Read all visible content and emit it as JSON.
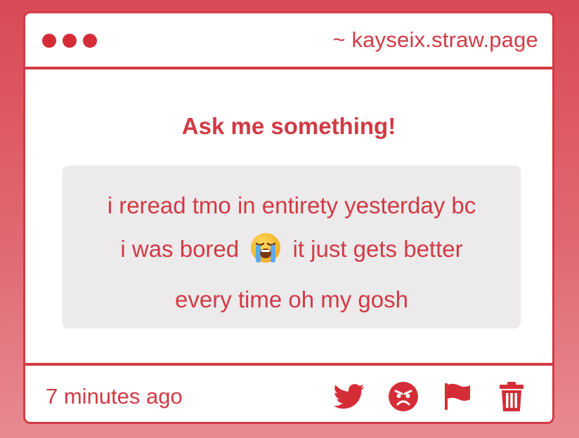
{
  "window": {
    "url": "~ kayseix.straw.page",
    "controls": [
      "dot-icon",
      "dot-icon",
      "dot-icon"
    ]
  },
  "main": {
    "heading": "Ask me something!",
    "message": {
      "line1": "i reread tmo in entirety yesterday bc",
      "line2_before": "i was bored",
      "line2_emoji": "loudly-crying-face-emoji",
      "line2_after": "it just gets better",
      "line3": "every time oh my gosh"
    }
  },
  "footer": {
    "timestamp": "7 minutes ago",
    "actions": [
      "twitter-icon",
      "angry-face-icon",
      "flag-icon",
      "trash-icon"
    ]
  },
  "colors": {
    "accent": "#d23a44",
    "message_bg": "#eceaeb",
    "background_top": "#d94a55",
    "background_bottom": "#e88a92"
  }
}
